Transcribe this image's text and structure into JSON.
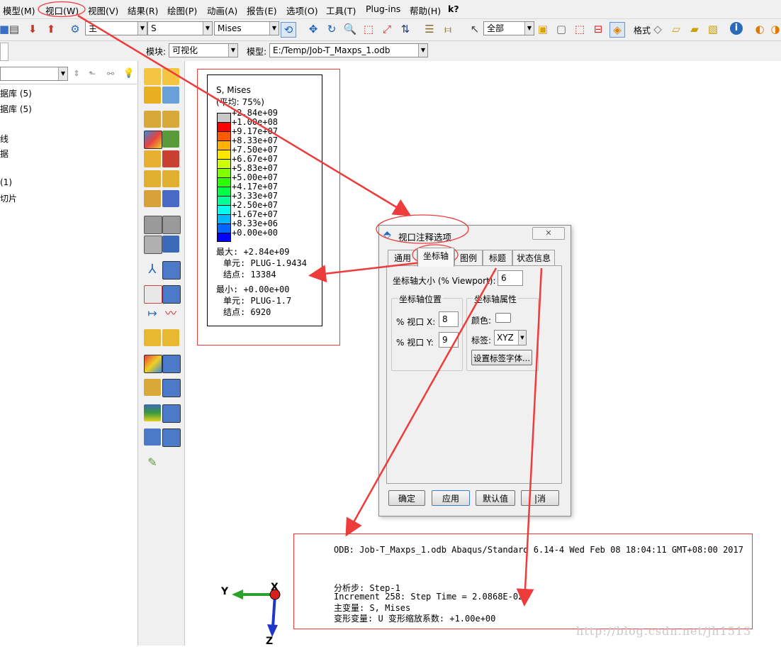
{
  "menu": {
    "items": [
      "模型(M)",
      "视口(W)",
      "视图(V)",
      "结果(R)",
      "绘图(P)",
      "动画(A)",
      "报告(E)",
      "选项(O)",
      "工具(T)",
      "Plug-ins",
      "帮助(H)"
    ],
    "help_cursor": "k?"
  },
  "toolbar": {
    "combo_main": "主",
    "combo_variable": "S",
    "combo_invariant": "Mises",
    "combo_selection": "全部",
    "label_format": "格式"
  },
  "context": {
    "module_label": "模块:",
    "module_value": "可视化",
    "model_label": "模型:",
    "model_value": "E:/Temp/Job-T_Maxps_1.odb"
  },
  "tree": {
    "items": [
      "据库 (5)",
      "据库 (5)",
      "线",
      "据",
      "(1)",
      "切片"
    ]
  },
  "legend": {
    "title": "S, Mises",
    "subtitle": "(平均: 75%)",
    "levels": [
      "+2.84e+09",
      "+1.00e+08",
      "+9.17e+07",
      "+8.33e+07",
      "+7.50e+07",
      "+6.67e+07",
      "+5.83e+07",
      "+5.00e+07",
      "+4.17e+07",
      "+3.33e+07",
      "+2.50e+07",
      "+1.67e+07",
      "+8.33e+06",
      "+0.00e+00"
    ],
    "colors": [
      "#c8c8c8",
      "#ff0000",
      "#ff5a00",
      "#ffb000",
      "#ffe600",
      "#ccff00",
      "#7fff00",
      "#2bff00",
      "#00ff44",
      "#00ff99",
      "#00ffee",
      "#00b8ff",
      "#0066ff",
      "#0000ff"
    ],
    "max_line": "最大: +2.84e+09",
    "max_elem": "单元: PLUG-1.9434",
    "max_node": "结点: 13384",
    "min_line": "最小: +0.00e+00",
    "min_elem": "单元: PLUG-1.7",
    "min_node": "结点: 6920"
  },
  "dialog": {
    "title": "视口注释选项",
    "close": "✕",
    "tabs": [
      "通用",
      "坐标轴",
      "图例",
      "标题",
      "状态信息"
    ],
    "axis_size_label": "坐标轴大小 (% Viewport):",
    "axis_size_value": "6",
    "position_group": "坐标轴位置",
    "x_label": "% 视口 X:",
    "x_value": "8",
    "y_label": "% 视口 Y:",
    "y_value": "9",
    "attr_group": "坐标轴属性",
    "color_label": "颜色:",
    "tag_label": "标签:",
    "tag_value": "XYZ",
    "font_button": "设置标签字体...",
    "ok": "确定",
    "apply": "应用",
    "defaults": "默认值",
    "cancel": "取消",
    "cancel_visible": "|消"
  },
  "status_block": {
    "line1": "ODB: Job-T_Maxps_1.odb    Abaqus/Standard 6.14-4    Wed Feb 08 18:04:11 GMT+08:00 2017",
    "line2": "分析步: Step-1",
    "line3": "Increment    258: Step Time =    2.0868E-02",
    "line4": "主变量: S, Mises",
    "line5": "变形变量: U   变形缩放系数: +1.00e+00"
  },
  "triad": {
    "y": "Y",
    "x": "X",
    "z": "Z"
  },
  "watermark": "http://blog.csdn.net/jh1513",
  "colors": {
    "annotation_red": "#ee3b3b",
    "dialog_bg": "#f0f0f0"
  }
}
